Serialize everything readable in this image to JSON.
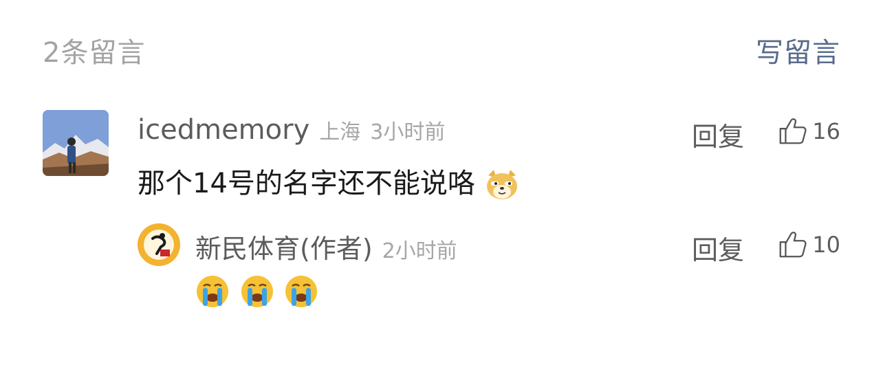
{
  "header": {
    "count_label": "2条留言",
    "write_label": "写留言"
  },
  "comments": [
    {
      "username": "icedmemory",
      "location": "上海",
      "time": "3小时前",
      "reply_label": "回复",
      "likes": "16",
      "text": "那个14号的名字还不能说咯",
      "emoji": "doge-emoji"
    },
    {
      "username": "新民体育(作者)",
      "time": "2小时前",
      "reply_label": "回复",
      "likes": "10",
      "emojis": [
        "crying-emoji",
        "crying-emoji",
        "crying-emoji"
      ]
    }
  ],
  "colors": {
    "accent": "#586b8c",
    "muted": "#a6a6a6",
    "text": "#1a1a1a"
  }
}
